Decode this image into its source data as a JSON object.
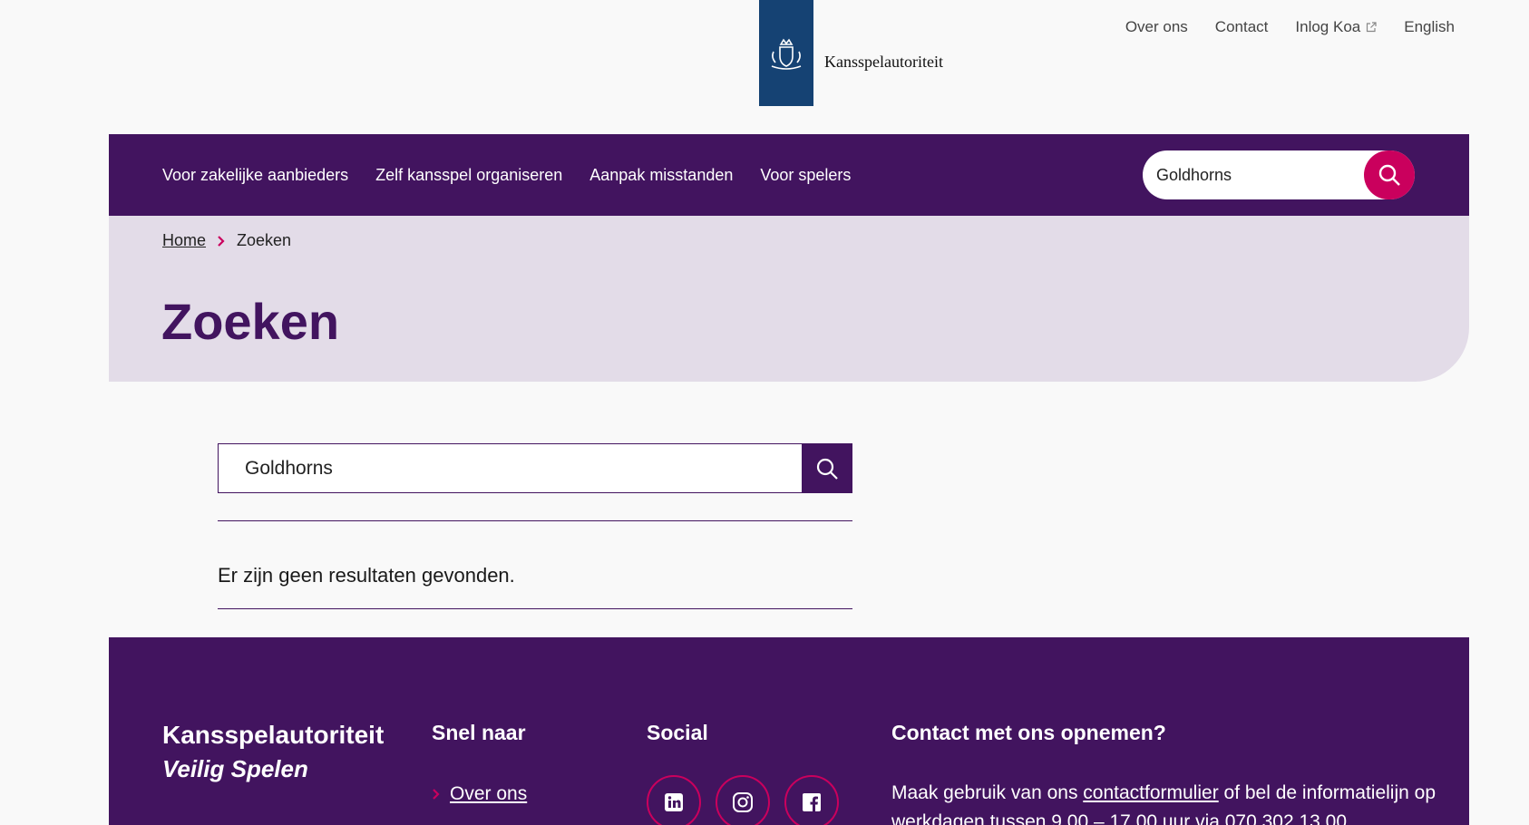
{
  "header": {
    "logo_text": "Kansspelautoriteit",
    "top_links": [
      "Over ons",
      "Contact",
      "Inlog Koa",
      "English"
    ]
  },
  "nav": {
    "items": [
      "Voor zakelijke aanbieders",
      "Zelf kansspel organiseren",
      "Aanpak misstanden",
      "Voor spelers"
    ],
    "search_value": "Goldhorns"
  },
  "breadcrumb": {
    "home": "Home",
    "current": "Zoeken"
  },
  "page": {
    "title": "Zoeken"
  },
  "search": {
    "value": "Goldhorns",
    "no_results": "Er zijn geen resultaten gevonden."
  },
  "footer": {
    "brand_line1": "Kansspelautoriteit",
    "brand_line2": "Veilig Spelen",
    "snel_title": "Snel naar",
    "snel_link": "Over ons",
    "social_title": "Social",
    "socials": [
      "linkedin-icon",
      "instagram-icon",
      "facebook-icon"
    ],
    "contact_title": "Contact met ons opnemen?",
    "contact_pre": "Maak gebruik van ons ",
    "contact_link": "contactformulier",
    "contact_post": " of bel de informatielijn op werkdagen tussen 9.00 – 17.00 uur via 070 302 13 00."
  },
  "colors": {
    "brand_purple": "#42145f",
    "accent_pink": "#ca005d",
    "logo_blue": "#154273",
    "hero_bg": "#e3dce8"
  }
}
